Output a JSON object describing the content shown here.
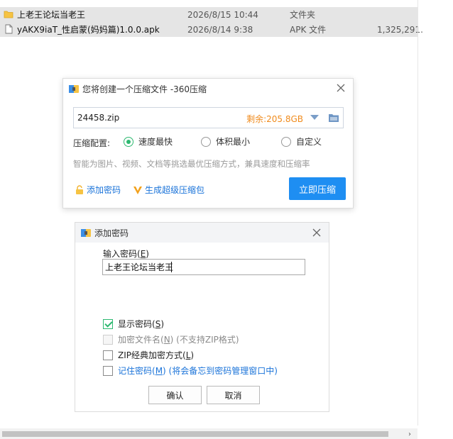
{
  "file_list": {
    "rows": [
      {
        "name": "上老王论坛当老王",
        "date": "2026/8/15 10:44",
        "type": "文件夹",
        "size": "",
        "icon": "folder-icon"
      },
      {
        "name": "yAKX9iaT_性启蒙(妈妈篇)1.0.0.apk",
        "date": "2026/8/14 9:38",
        "type": "APK 文件",
        "size": "1,325,291.",
        "icon": "file-icon"
      }
    ],
    "scroll_arrow": "›"
  },
  "compress_dialog": {
    "title": "您将创建一个压缩文件 -360压缩",
    "filename": "24458.zip",
    "free_space": "剩余:205.8GB",
    "config_label": "压缩配置:",
    "options": [
      "速度最快",
      "体积最小",
      "自定义"
    ],
    "selected_option": "速度最快",
    "hint": "智能为图片、视频、文档等挑选最优压缩方式，兼具速度和压缩率",
    "add_password": "添加密码",
    "super_pack": "生成超级压缩包",
    "compress_button": "立即压缩",
    "accent_color": "#1e8ef2",
    "free_color": "#f08b1d"
  },
  "password_dialog": {
    "title": "添加密码",
    "input_label_prefix": "输入密码(",
    "input_label_key": "E",
    "input_label_suffix": ")",
    "password_value": "上老王论坛当老王",
    "checkboxes": [
      {
        "label_prefix": "显示密码(",
        "key": "S",
        "label_suffix": ")",
        "checked": true,
        "disabled": false
      },
      {
        "label_prefix": "加密文件名(",
        "key": "N",
        "label_suffix": ") (不支持ZIP格式)",
        "checked": false,
        "disabled": true
      },
      {
        "label_prefix": "ZIP经典加密方式(",
        "key": "L",
        "label_suffix": ")",
        "checked": false,
        "disabled": false
      },
      {
        "label_prefix": "记住密码(",
        "key": "M",
        "label_suffix": ") (将会备忘到密码管理窗口中)",
        "checked": false,
        "disabled": false
      }
    ],
    "ok_button": "确认",
    "cancel_button": "取消"
  }
}
